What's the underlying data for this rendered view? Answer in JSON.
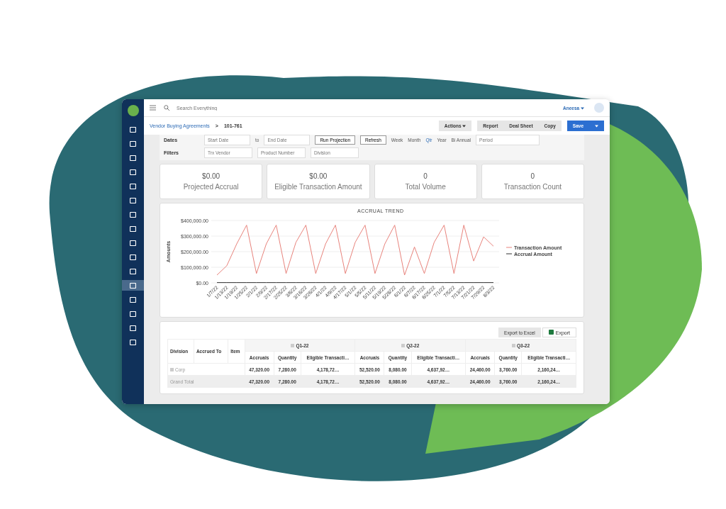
{
  "topbar": {
    "search_placeholder": "Search Everything",
    "user": "Aneesa"
  },
  "sidebar": {
    "items": [
      {
        "selected": false
      },
      {
        "selected": false
      },
      {
        "selected": false
      },
      {
        "selected": false
      },
      {
        "selected": false
      },
      {
        "selected": false
      },
      {
        "selected": false
      },
      {
        "selected": false
      },
      {
        "selected": false
      },
      {
        "selected": false
      },
      {
        "selected": false
      },
      {
        "selected": true
      },
      {
        "selected": false
      },
      {
        "selected": false
      },
      {
        "selected": false
      },
      {
        "selected": false
      }
    ]
  },
  "breadcrumb": {
    "parent": "Vendor Buying Agreements",
    "separator": ">",
    "current": "101-761"
  },
  "actions": {
    "menu": "Actions",
    "buttons": [
      "Report",
      "Deal Sheet",
      "Copy"
    ],
    "save": "Save"
  },
  "dates": {
    "label": "Dates",
    "start_placeholder": "Start Date",
    "to": "to",
    "end_placeholder": "End Date",
    "run": "Run Projection",
    "refresh": "Refresh",
    "periods": [
      {
        "label": "Week",
        "selected": false
      },
      {
        "label": "Month",
        "selected": false
      },
      {
        "label": "Qtr",
        "selected": true
      },
      {
        "label": "Year",
        "selected": false
      },
      {
        "label": "Bi Annual",
        "selected": false
      }
    ],
    "period_placeholder": "Period"
  },
  "filters": {
    "label": "Filters",
    "vendor_placeholder": "Trx Vendor",
    "product_placeholder": "Product Number",
    "division_placeholder": "Division"
  },
  "stats": [
    {
      "value": "$0.00",
      "label": "Projected Accrual"
    },
    {
      "value": "$0.00",
      "label": "Eligible Transaction Amount"
    },
    {
      "value": "0",
      "label": "Total Volume"
    },
    {
      "value": "0",
      "label": "Transaction Count"
    }
  ],
  "chart": {
    "chart_data": {
      "type": "line",
      "title": "ACCRUAL TREND",
      "ylabel": "Amounts",
      "categories": [
        "1/7/22",
        "1/13/22",
        "1/19/22",
        "1/25/22",
        "2/1/22",
        "2/9/22",
        "2/17/22",
        "2/25/22",
        "3/6/22",
        "3/16/22",
        "3/26/22",
        "4/1/22",
        "4/9/22",
        "4/17/22",
        "5/1/22",
        "5/5/22",
        "5/11/22",
        "5/19/22",
        "5/28/22",
        "6/1/22",
        "6/7/22",
        "6/17/22",
        "6/25/22",
        "7/1/22",
        "7/5/22",
        "7/13/22",
        "7/21/22",
        "7/29/22",
        "8/3/22"
      ],
      "series": [
        {
          "name": "Transaction Amount",
          "color": "#e8837c",
          "values": [
            50000,
            110000,
            250000,
            370000,
            60000,
            250000,
            370000,
            60000,
            260000,
            370000,
            60000,
            250000,
            370000,
            60000,
            260000,
            370000,
            60000,
            250000,
            370000,
            50000,
            230000,
            60000,
            260000,
            370000,
            60000,
            370000,
            140000,
            295000,
            235000
          ]
        },
        {
          "name": "Accrual Amount",
          "color": "#333333",
          "values": [
            2000,
            2000,
            2000,
            2000,
            2000,
            2000,
            2000,
            2000,
            2000,
            2000,
            2000,
            2000,
            2000,
            2000,
            2000,
            2000,
            2000,
            2000,
            2000,
            2000,
            2000,
            2000,
            2000,
            2000,
            2000,
            2000,
            2000,
            2000,
            2000
          ]
        }
      ],
      "ylim": [
        0,
        400000
      ],
      "grid": true,
      "legend": true,
      "yticks": [
        {
          "value": 0,
          "label": "$0.00"
        },
        {
          "value": 100000,
          "label": "$100,000.00"
        },
        {
          "value": 200000,
          "label": "$200,000.00"
        },
        {
          "value": 300000,
          "label": "$300,000.00"
        },
        {
          "value": 400000,
          "label": "$400,000.00"
        }
      ]
    }
  },
  "table": {
    "export_to_excel": "Export to Excel",
    "export": "Export",
    "fixed_columns": [
      "Division",
      "Accrued To",
      "Item"
    ],
    "groups": [
      {
        "label": "Q1-22",
        "columns": [
          "Accruals",
          "Quantity",
          "Eligible Transacti…"
        ]
      },
      {
        "label": "Q2-22",
        "columns": [
          "Accruals",
          "Quantity",
          "Eligible Transacti…"
        ]
      },
      {
        "label": "Q3-22",
        "columns": [
          "Accruals",
          "Quantity",
          "Eligible Transacti…"
        ]
      }
    ],
    "rows": [
      {
        "label": "Corp",
        "kind": "group",
        "cells": [
          "47,320.00",
          "7,280.00",
          "4,178,72…",
          "52,520.00",
          "8,080.00",
          "4,637,92…",
          "24,460.00",
          "3,760.00",
          "2,160,24…"
        ]
      },
      {
        "label": "Grand Total",
        "kind": "total",
        "cells": [
          "47,320.00",
          "7,280.00",
          "4,178,72…",
          "52,520.00",
          "8,080.00",
          "4,637,92…",
          "24,460.00",
          "3,760.00",
          "2,160,24…"
        ]
      }
    ]
  }
}
